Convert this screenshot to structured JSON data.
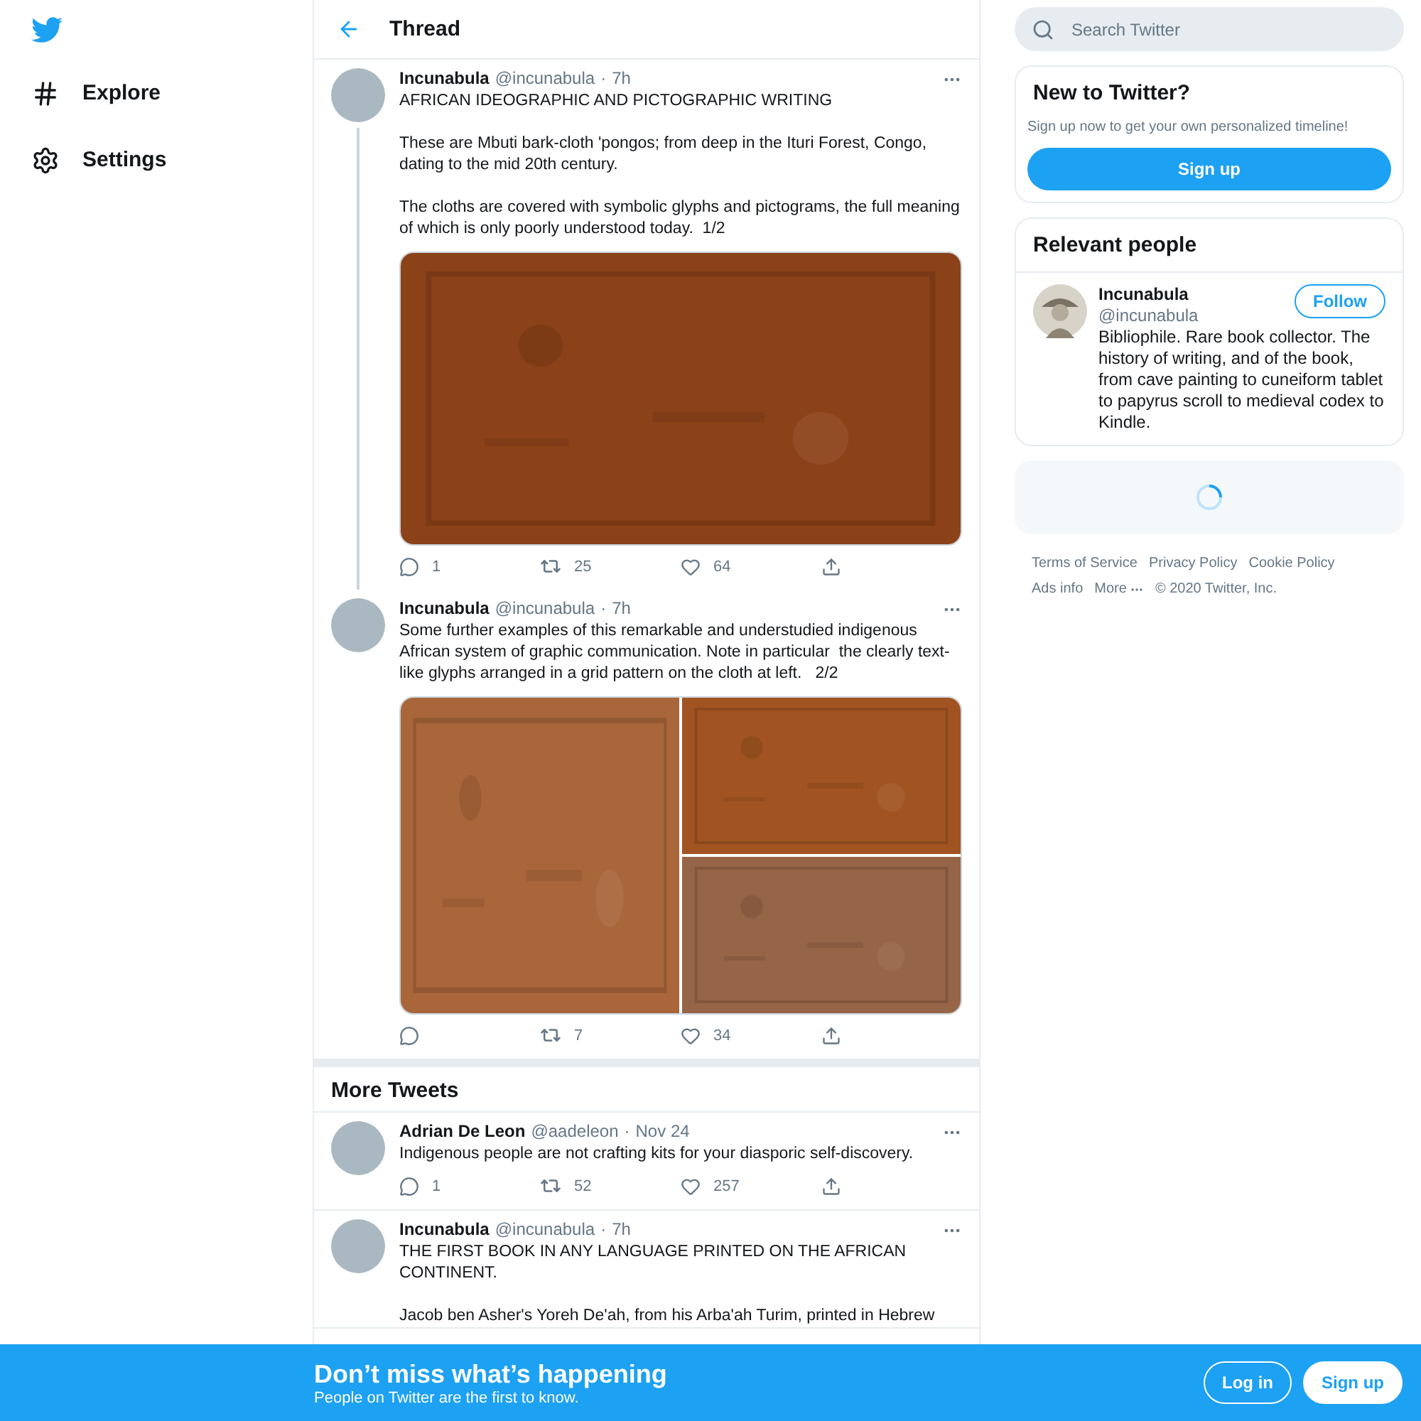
{
  "nav": {
    "items": [
      {
        "label": "Explore",
        "kind": "explore"
      },
      {
        "label": "Settings",
        "kind": "settings"
      }
    ]
  },
  "header": {
    "title": "Thread"
  },
  "thread": [
    {
      "name": "Incunabula",
      "handle": "@incunabula",
      "separator": "·",
      "time": "7h",
      "connected": true,
      "paragraphs": [
        "AFRICAN IDEOGRAPHIC AND PICTOGRAPHIC WRITING",
        "These are Mbuti bark-cloth 'pongos; from deep in the Ituri Forest, Congo, dating to the mid 20th century.",
        "The cloths are covered with symbolic glyphs and pictograms, the full meaning of which is only poorly understood today.  1/2"
      ],
      "media": [
        {
          "kind": "picture"
        }
      ],
      "replies": "1",
      "retweets": "25",
      "likes": "64"
    },
    {
      "name": "Incunabula",
      "handle": "@incunabula",
      "separator": "·",
      "time": "7h",
      "connected": false,
      "paragraphs": [
        "Some further examples of this remarkable and understudied indigenous African system of graphic communication. Note in particular  the clearly text-like glyphs arranged in a grid pattern on the cloth at left.   2/2"
      ],
      "media": [
        {
          "kind": "picture"
        },
        {
          "kind": "picture"
        },
        {
          "kind": "picture"
        }
      ],
      "retweets": "7",
      "likes": "34"
    }
  ],
  "more_tweets": {
    "title": "More Tweets",
    "tweets": [
      {
        "name": "Adrian De Leon",
        "handle": "@aadeleon",
        "separator": "·",
        "time": "Nov 24",
        "paragraphs": [
          "Indigenous people are not crafting kits for your diasporic self-discovery."
        ],
        "replies": "1",
        "retweets": "52",
        "likes": "257"
      },
      {
        "name": "Incunabula",
        "handle": "@incunabula",
        "separator": "·",
        "time": "7h",
        "paragraphs": [
          "THE FIRST BOOK IN ANY LANGUAGE PRINTED ON THE AFRICAN CONTINENT.",
          "Jacob ben Asher's Yoreh De'ah, from his Arba'ah Turim, printed in Hebrew"
        ]
      }
    ]
  },
  "search": {
    "placeholder": "Search Twitter"
  },
  "signup_card": {
    "title": "New to Twitter?",
    "text": "Sign up now to get your own personalized timeline!",
    "button": "Sign up"
  },
  "relevant_people": {
    "title": "Relevant people",
    "people": [
      {
        "name": "Incunabula",
        "handle": "@incunabula",
        "button": "Follow",
        "bio": "Bibliophile. Rare book collector. The history of writing, and of the book, from cave painting to cuneiform tablet to papyrus scroll to medieval codex to Kindle."
      }
    ]
  },
  "footer": {
    "links": [
      "Terms of Service",
      "Privacy Policy",
      "Cookie Policy",
      "Ads info",
      "More"
    ],
    "copyright": "© 2020 Twitter, Inc."
  },
  "banner": {
    "title": "Don’t miss what’s happening",
    "subtitle": "People on Twitter are the first to know.",
    "buttons": [
      {
        "label": "Log in",
        "kind": "outline"
      },
      {
        "label": "Sign up",
        "kind": "filled"
      }
    ]
  }
}
